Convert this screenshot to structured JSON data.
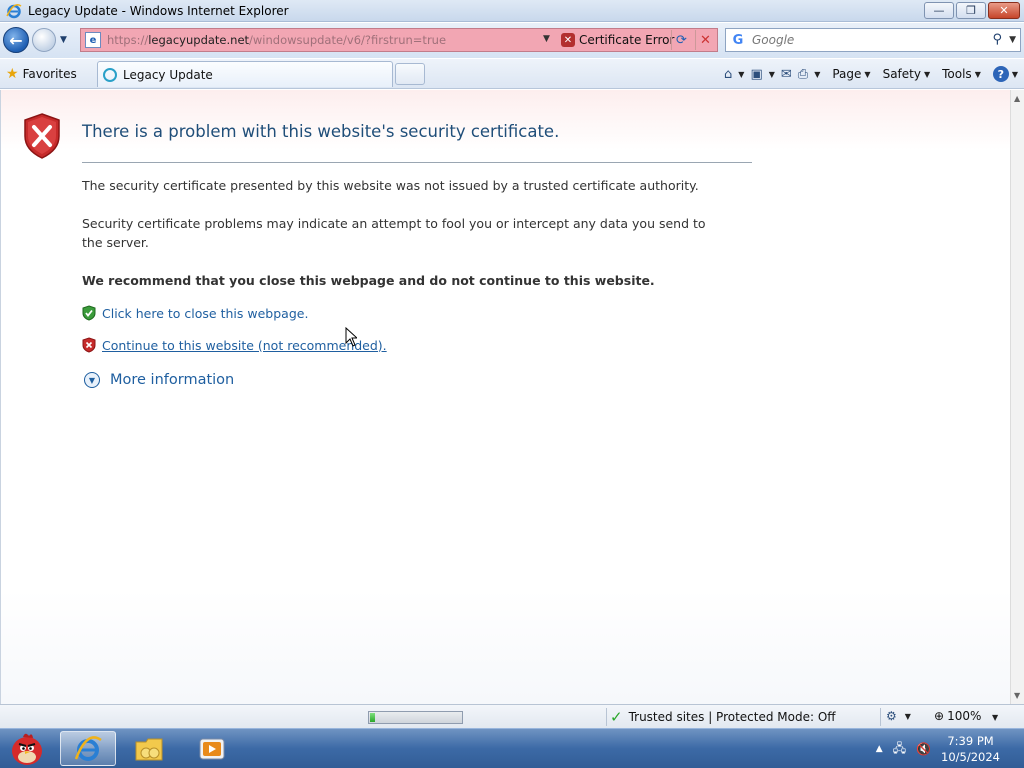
{
  "window": {
    "title": "Legacy Update - Windows Internet Explorer",
    "minimize_glyph": "—",
    "restore_glyph": "❐",
    "close_glyph": "✕"
  },
  "nav": {
    "url_prefix": "https://",
    "url_host": "legacyupdate.net",
    "url_path": "/windowsupdate/v6/?firstrun=true",
    "certificate_error_label": "Certificate Error",
    "search_placeholder": "Google"
  },
  "commandbar": {
    "favorites_label": "Favorites",
    "tab_label": "Legacy Update",
    "page_label": "Page",
    "safety_label": "Safety",
    "tools_label": "Tools"
  },
  "content": {
    "heading": "There is a problem with this website's security certificate.",
    "paragraph1": "The security certificate presented by this website was not issued by a trusted certificate authority.",
    "paragraph2": "Security certificate problems may indicate an attempt to fool you or intercept any data you send to the server.",
    "recommendation": "We recommend that you close this webpage and do not continue to this website.",
    "close_link": "Click here to close this webpage.",
    "continue_link": "Continue to this website (not recommended).",
    "more_info": "More information"
  },
  "status": {
    "zone_text": "Trusted sites | Protected Mode: Off",
    "zoom_text": "100%",
    "progress": 0.05
  },
  "taskbar": {
    "time": "7:39 PM",
    "date": "10/5/2024"
  },
  "colors": {
    "address_error_bg": "#f2a6b3",
    "link": "#1f5fa0",
    "heading": "#1f4e79",
    "taskbar": "#3c6aa6"
  },
  "icons": {
    "app": "ie-icon",
    "back": "back-arrow-icon",
    "forward": "forward-arrow-icon",
    "cert_error": "cert-error-icon",
    "refresh": "refresh-icon",
    "stop": "stop-icon",
    "search": "search-icon",
    "favorites": "star-icon",
    "home": "home-icon",
    "feeds": "rss-icon",
    "mail": "mail-icon",
    "print": "print-icon",
    "help": "help-icon",
    "shield_error": "shield-error-icon",
    "shield_ok": "shield-ok-icon",
    "expand": "expand-circle-icon"
  }
}
